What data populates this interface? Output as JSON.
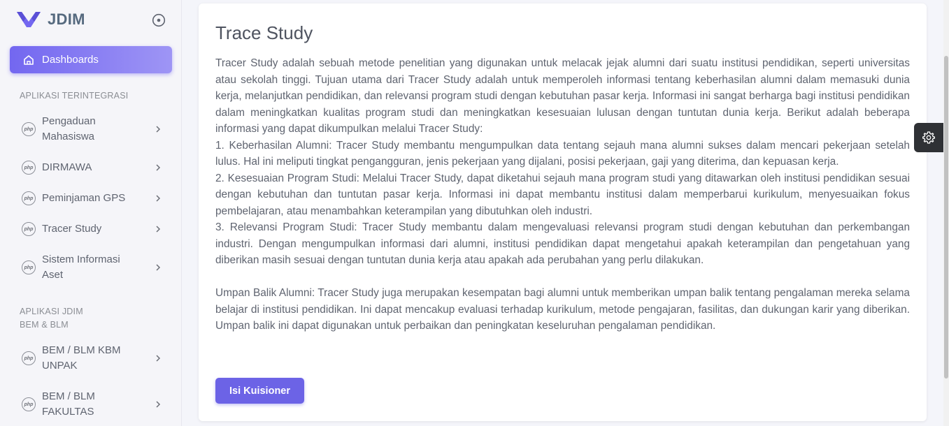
{
  "brand": {
    "name": "JDIM",
    "logo_icon": "jdim-v-logo-icon",
    "accent": "#7367f0"
  },
  "sidebar": {
    "collapse_icon": "circle-dot-icon",
    "dashboard": {
      "label": "Dashboards",
      "icon": "home-icon"
    },
    "section1": "APLIKASI TERINTEGRASI",
    "integrated_items": [
      {
        "label": "Pengaduan Mahasiswa",
        "icon": "php-icon"
      },
      {
        "label": "DIRMAWA",
        "icon": "php-icon"
      },
      {
        "label": "Peminjaman GPS",
        "icon": "php-icon"
      },
      {
        "label": "Tracer Study",
        "icon": "php-icon"
      },
      {
        "label": "Sistem Informasi Aset",
        "icon": "php-icon"
      }
    ],
    "section2_line1": "APLIKASI JDIM",
    "section2_line2": "BEM & BLM",
    "jdim_items": [
      {
        "label": "BEM / BLM KBM UNPAK",
        "icon": "php-icon"
      },
      {
        "label": "BEM / BLM FAKULTAS",
        "icon": "php-icon"
      }
    ]
  },
  "card": {
    "title": "Trace Study",
    "intro": "Tracer Study adalah sebuah metode penelitian yang digunakan untuk melacak jejak alumni dari suatu institusi pendidikan, seperti universitas atau sekolah tinggi. Tujuan utama dari Tracer Study adalah untuk memperoleh informasi tentang keberhasilan alumni dalam memasuki dunia kerja, melanjutkan pendidikan, dan relevansi program studi dengan kebutuhan pasar kerja. Informasi ini sangat berharga bagi institusi pendidikan dalam meningkatkan kualitas program studi dan meningkatkan kesesuaian lulusan dengan tuntutan dunia kerja. Berikut adalah beberapa informasi yang dapat dikumpulkan melalui Tracer Study:",
    "point1": "1. Keberhasilan Alumni: Tracer Study membantu mengumpulkan data tentang sejauh mana alumni sukses dalam mencari pekerjaan setelah lulus. Hal ini meliputi tingkat pengangguran, jenis pekerjaan yang dijalani, posisi pekerjaan, gaji yang diterima, dan kepuasan kerja.",
    "point2": "2. Kesesuaian Program Studi: Melalui Tracer Study, dapat diketahui sejauh mana program studi yang ditawarkan oleh institusi pendidikan sesuai dengan kebutuhan dan tuntutan pasar kerja. Informasi ini dapat membantu institusi dalam memperbarui kurikulum, menyesuaikan fokus pembelajaran, atau menambahkan keterampilan yang dibutuhkan oleh industri.",
    "point3": "3. Relevansi Program Studi: Tracer Study membantu dalam mengevaluasi relevansi program studi dengan kebutuhan dan perkembangan industri. Dengan mengumpulkan informasi dari alumni, institusi pendidikan dapat mengetahui apakah keterampilan dan pengetahuan yang diberikan masih sesuai dengan tuntutan dunia kerja atau apakah ada perubahan yang perlu dilakukan.",
    "feedback": "Umpan Balik Alumni: Tracer Study juga merupakan kesempatan bagi alumni untuk memberikan umpan balik tentang pengalaman mereka selama belajar di institusi pendidikan. Ini dapat mencakup evaluasi terhadap kurikulum, metode pengajaran, fasilitas, dan dukungan karir yang diberikan. Umpan balik ini dapat digunakan untuk perbaikan dan peningkatan keseluruhan pengalaman pendidikan.",
    "button_label": "Isi Kuisioner"
  },
  "floating": {
    "settings_icon": "gear-icon"
  }
}
